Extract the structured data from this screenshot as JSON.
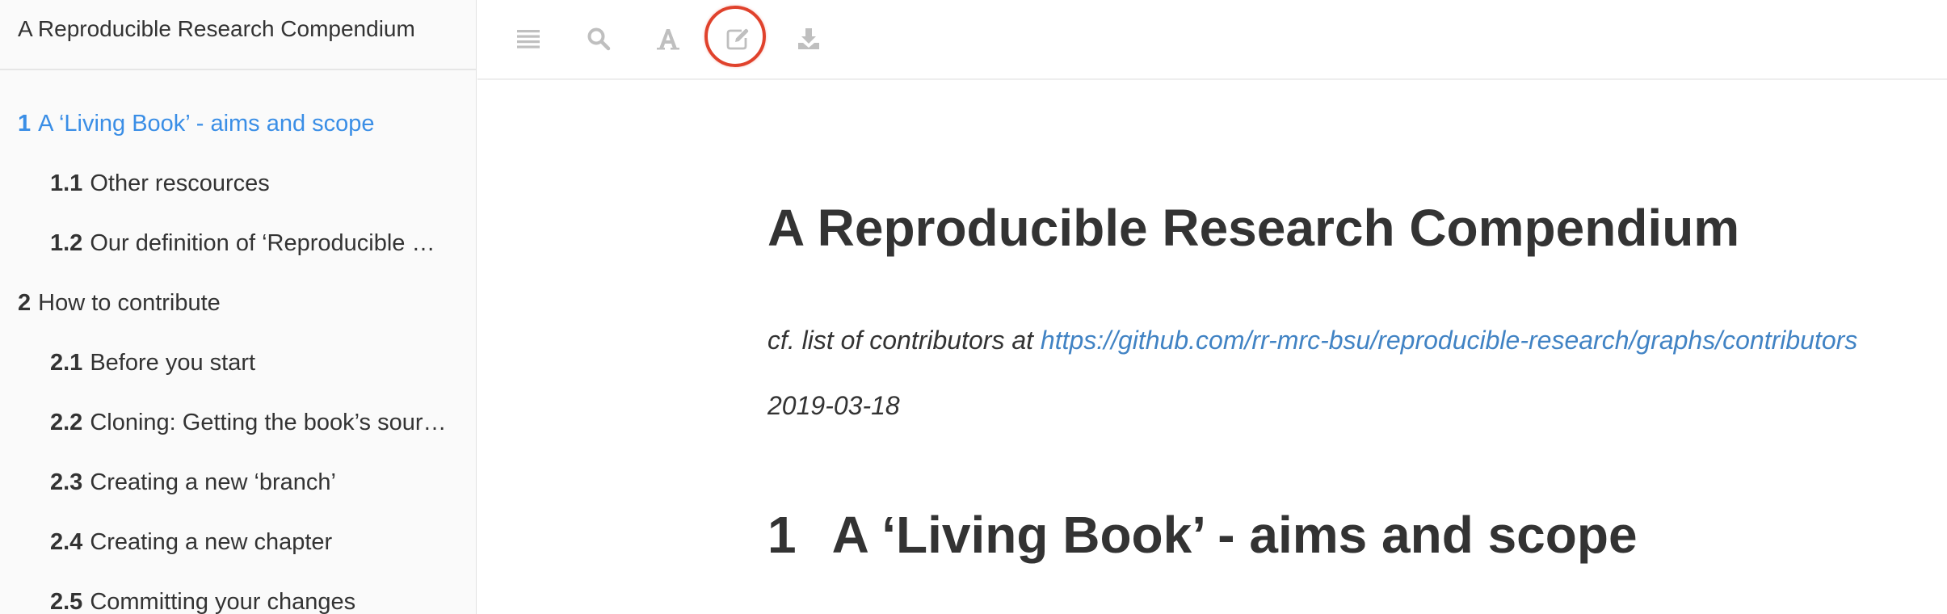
{
  "sidebar": {
    "title": "A Reproducible Research Compendium",
    "items": [
      {
        "num": "1",
        "label": "A ‘Living Book’ - aims and scope",
        "level": 1,
        "active": true
      },
      {
        "num": "1.1",
        "label": "Other rescources",
        "level": 2,
        "active": false
      },
      {
        "num": "1.2",
        "label": "Our definition of ‘Reproducible …",
        "level": 2,
        "active": false
      },
      {
        "num": "2",
        "label": "How to contribute",
        "level": 1,
        "active": false
      },
      {
        "num": "2.1",
        "label": "Before you start",
        "level": 2,
        "active": false
      },
      {
        "num": "2.2",
        "label": "Cloning: Getting the book’s sour…",
        "level": 2,
        "active": false
      },
      {
        "num": "2.3",
        "label": "Creating a new ‘branch’",
        "level": 2,
        "active": false
      },
      {
        "num": "2.4",
        "label": "Creating a new chapter",
        "level": 2,
        "active": false
      },
      {
        "num": "2.5",
        "label": "Committing your changes",
        "level": 2,
        "active": false
      }
    ]
  },
  "toolbar": {
    "icons": [
      "toc-toggle-icon",
      "search-icon",
      "font-settings-icon",
      "edit-icon",
      "download-icon"
    ],
    "highlighted": "edit-icon",
    "highlight_color": "#e0422c",
    "icon_color": "#bfbfbf"
  },
  "main": {
    "title": "A Reproducible Research Compendium",
    "contributors_prefix": "cf. list of contributors at",
    "contributors_link": "https://github.com/rr-mrc-bsu/reproducible-research/graphs/contributors",
    "date": "2019-03-18",
    "section_number": "1",
    "section_title": "A ‘Living Book’ - aims and scope"
  },
  "colors": {
    "accent": "#3a8ee6",
    "link": "#4183c4",
    "text": "#333333",
    "sidebar_bg": "#fafafa"
  }
}
